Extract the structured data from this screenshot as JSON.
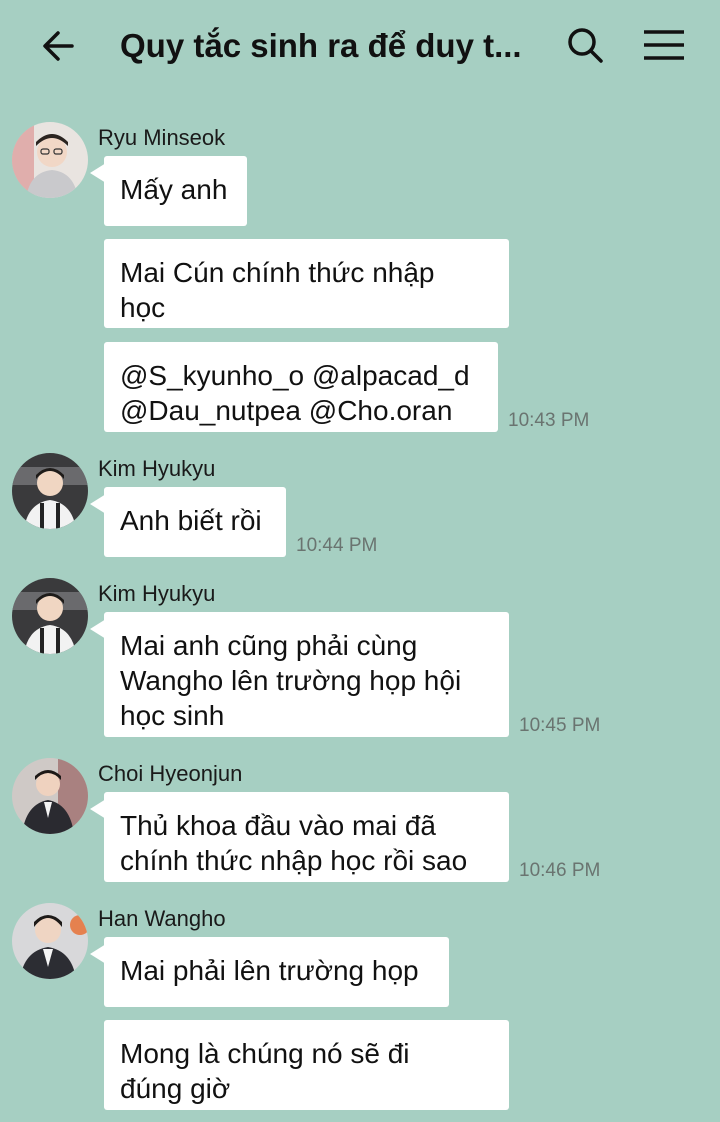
{
  "header": {
    "title": "Quy tắc sinh ra để duy t...",
    "back_icon": "arrow-left-icon",
    "search_icon": "search-icon",
    "menu_icon": "hamburger-menu-icon"
  },
  "colors": {
    "background": "#a6cfc2",
    "bubble": "#ffffff",
    "timestamp": "#6a7470"
  },
  "messages": [
    {
      "sender": "Ryu Minseok",
      "bubbles": [
        {
          "lines": [
            "Mấy anh"
          ]
        },
        {
          "lines": [
            "Mai Cún chính thức nhập",
            "học"
          ]
        },
        {
          "lines": [
            "@S_kyunho_o @alpacad_d",
            "@Dau_nutpea @Cho.oran"
          ]
        }
      ],
      "time": "10:43 PM"
    },
    {
      "sender": "Kim Hyukyu",
      "bubbles": [
        {
          "lines": [
            "Anh biết rồi"
          ]
        }
      ],
      "time": "10:44 PM"
    },
    {
      "sender": "Kim Hyukyu",
      "bubbles": [
        {
          "lines": [
            "Mai anh cũng phải cùng",
            "Wangho lên trường họp hội",
            "học sinh"
          ]
        }
      ],
      "time": "10:45 PM"
    },
    {
      "sender": "Choi Hyeonjun",
      "bubbles": [
        {
          "lines": [
            "Thủ khoa đầu vào mai đã",
            "chính thức nhập học rồi sao"
          ]
        }
      ],
      "time": "10:46 PM"
    },
    {
      "sender": "Han Wangho",
      "bubbles": [
        {
          "lines": [
            "Mai phải lên trường họp"
          ]
        },
        {
          "lines": [
            "Mong là chúng nó sẽ đi",
            "đúng giờ"
          ]
        }
      ],
      "time": ""
    }
  ]
}
